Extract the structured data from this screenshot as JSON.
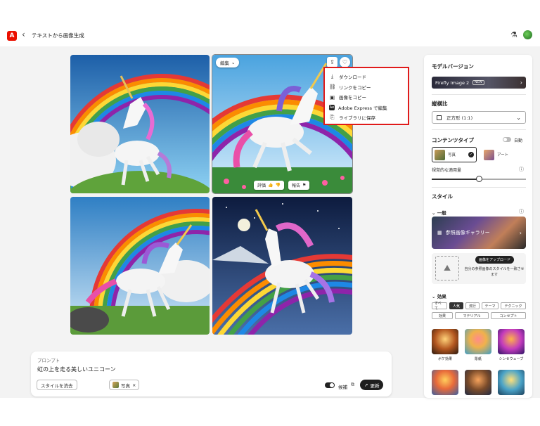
{
  "topbar": {
    "logo_text": "A",
    "back_glyph": "‹",
    "breadcrumb": "テキストから画像生成",
    "lab_icon": "flask-icon",
    "avatar_icon": "avatar"
  },
  "image_grid": {
    "edit_label": "編集",
    "menu": [
      {
        "icon": "⤓",
        "label": "ダウンロード"
      },
      {
        "icon": "🔗",
        "label": "リンクをコピー"
      },
      {
        "icon": "▣",
        "label": "画像をコピー"
      },
      {
        "icon": "Ae",
        "label": "Adobe Express で編集"
      },
      {
        "icon": "⎘",
        "label": "ライブラリに保存"
      }
    ],
    "rate_label": "評価",
    "report_label": "報告"
  },
  "prompt": {
    "label": "プロンプト",
    "text": "虹の上を走る美しいユニコーン",
    "clear_style": "スタイルを消去",
    "photo_tag": "写真",
    "photo_tag_close": "×",
    "generate_label": "候補",
    "refresh_label": "更新"
  },
  "panel": {
    "model_title": "モデルバージョン",
    "model_name": "Firefly Image 2",
    "model_badge": "NEW",
    "ratio_title": "縦横比",
    "ratio_value": "正方形 (1:1)",
    "content_title": "コンテンツタイプ",
    "auto_label": "自動",
    "content_photo": "写真",
    "content_art": "アート",
    "visual_label": "視覚的な適用量",
    "visual_intensity": 0.5,
    "style_title": "スタイル",
    "general_label": "一般",
    "gallery_label": "参照画像ギャラリー",
    "upload_btn": "画像をアップロード",
    "upload_desc": "自分の参照画像のスタイルを一致させます",
    "effects_label": "効果",
    "effect_chips": [
      "すべて",
      "人気",
      "流行",
      "テーマ",
      "テクニック",
      "効果",
      "マテリアル",
      "コンセプト"
    ],
    "effect_items": [
      "ボケ効果",
      "彫紙",
      "シンセウェーブ"
    ]
  },
  "colors": {
    "accent": "#eb1000",
    "highlight_border": "#e01a1a",
    "dark_button": "#1f1f1f"
  }
}
